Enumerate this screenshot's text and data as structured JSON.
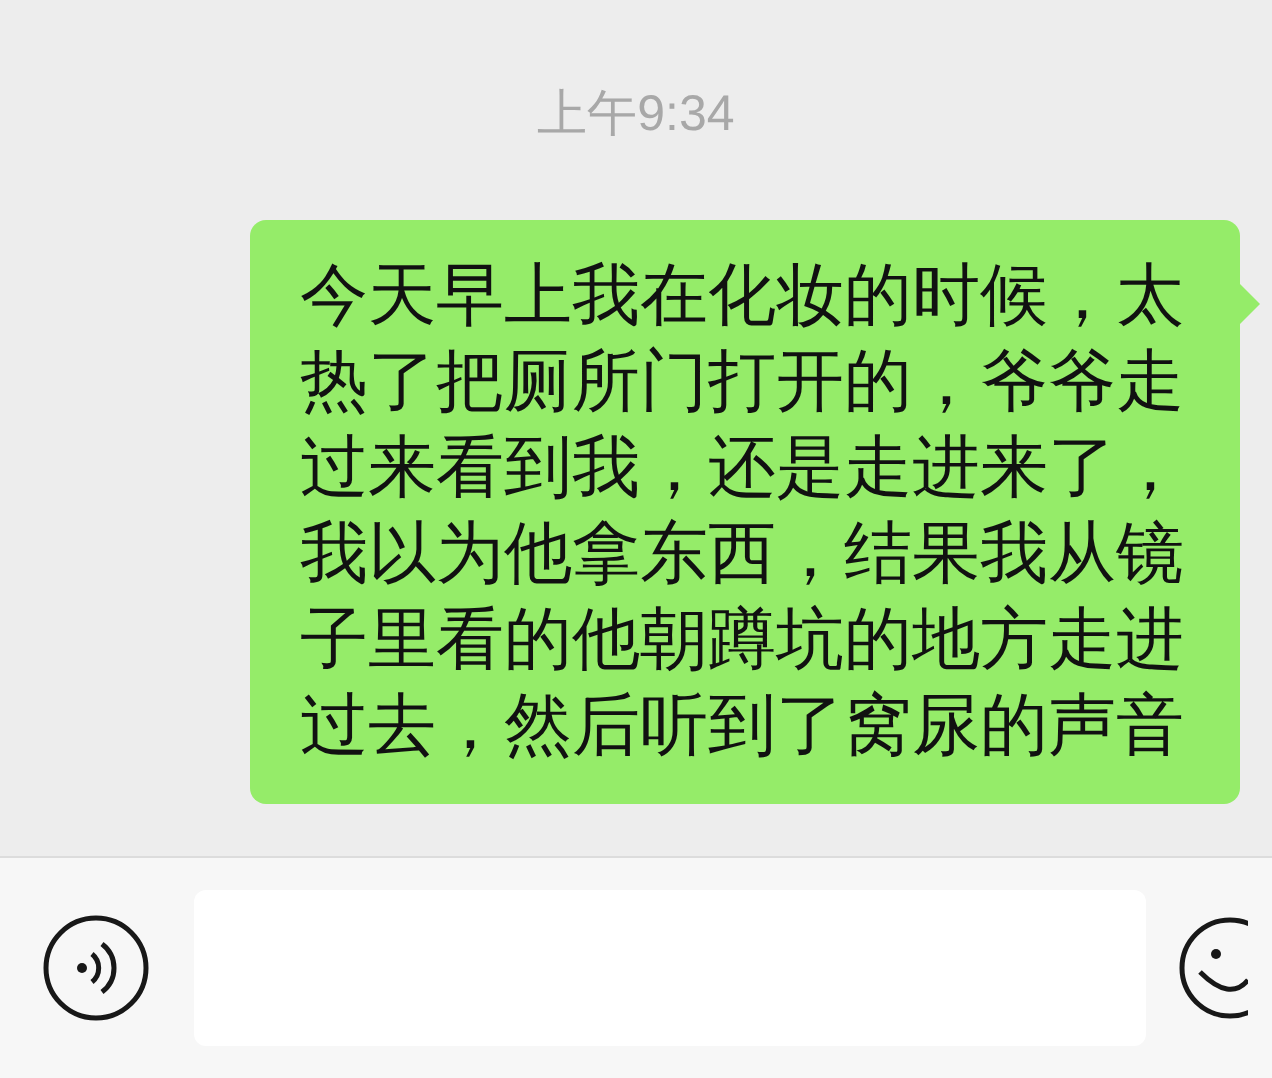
{
  "timestamp": "上午9:34",
  "messages": [
    {
      "kind": "outgoing",
      "text": "今天早上我在化妆的时候，太热了把厕所门打开的，爷爷走过来看到我，还是走进来了，我以为他拿东西，结果我从镜子里看的他朝蹲坑的地方走进过去，然后听到了窝尿的声音"
    }
  ]
}
